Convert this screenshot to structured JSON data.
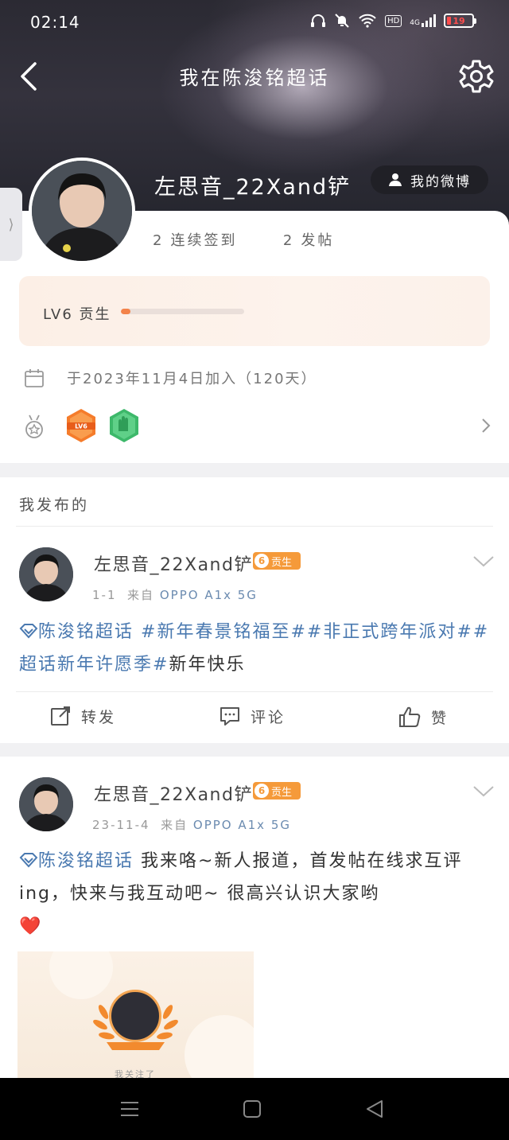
{
  "status_bar": {
    "time": "02:14",
    "network": "4G",
    "hd": "HD",
    "battery": "19"
  },
  "nav": {
    "title": "我在陈浚铭超话"
  },
  "profile": {
    "username": "左思音_22Xand铲",
    "weibo_button": "我的微博",
    "stats": [
      {
        "num": "2",
        "label": "连续签到"
      },
      {
        "num": "2",
        "label": "发帖"
      }
    ],
    "level": {
      "label": "LV6 贡生",
      "progress": 0.08
    },
    "join_text": "于2023年11月4日加入（120天）",
    "badges": [
      {
        "name": "lv-badge",
        "text": "LV6",
        "color": "#f57c2b"
      },
      {
        "name": "fan-badge",
        "text": "",
        "color": "#3db86a"
      }
    ]
  },
  "section_title": "我发布的",
  "posts": [
    {
      "author": "左思音_22Xand铲",
      "rank_num": "6",
      "rank_label": "贡生",
      "time": "1-1",
      "source_prefix": "来自",
      "device": "OPPO A1x 5G",
      "topic": "陈浚铭超话",
      "hashtags": "#新年春景铭福至##非正式跨年派对##超话新年许愿季#",
      "text": "新年快乐"
    },
    {
      "author": "左思音_22Xand铲",
      "rank_num": "6",
      "rank_label": "贡生",
      "time": "23-11-4",
      "source_prefix": "来自",
      "device": "OPPO A1x 5G",
      "topic": "陈浚铭超话",
      "text": "我来咯~新人报道，首发帖在线求互评ing，快来与我互动吧~ 很高兴认识大家哟",
      "emoji": "❤️",
      "image_caption": "我关注了"
    }
  ],
  "actions": {
    "repost": "转发",
    "comment": "评论",
    "like": "赞"
  },
  "colors": {
    "accent": "#f3834a",
    "topic": "#4a79b0",
    "rank": "#f59a3a"
  }
}
